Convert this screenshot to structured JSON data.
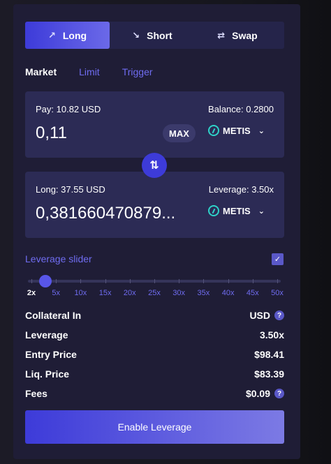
{
  "tabs": [
    {
      "label": "Long",
      "icon": "trend-up-icon",
      "glyph": "↗"
    },
    {
      "label": "Short",
      "icon": "trend-down-icon",
      "glyph": "↘"
    },
    {
      "label": "Swap",
      "icon": "swap-arrows-icon",
      "glyph": "⇄"
    }
  ],
  "order_types": [
    "Market",
    "Limit",
    "Trigger"
  ],
  "pay_box": {
    "pay_label": "Pay: 10.82 USD",
    "balance_label": "Balance: 0.2800",
    "amount": "0,11",
    "max_label": "MAX",
    "token": "METIS"
  },
  "long_box": {
    "long_label": "Long: 37.55 USD",
    "leverage_label": "Leverage: 3.50x",
    "amount": "0,381660470879...",
    "token": "METIS"
  },
  "leverage": {
    "label": "Leverage slider",
    "enabled": true,
    "marks": [
      "2x",
      "5x",
      "10x",
      "15x",
      "20x",
      "25x",
      "30x",
      "35x",
      "40x",
      "45x",
      "50x"
    ],
    "selected_fraction": 0.02
  },
  "info": [
    {
      "key": "Collateral In",
      "value": "USD",
      "help": true
    },
    {
      "key": "Leverage",
      "value": "3.50x",
      "help": false
    },
    {
      "key": "Entry Price",
      "value": "$98.41",
      "help": false
    },
    {
      "key": "Liq. Price",
      "value": "$83.39",
      "help": false
    },
    {
      "key": "Fees",
      "value": "$0.09",
      "help": true
    }
  ],
  "action": {
    "label": "Enable Leverage"
  },
  "colors": {
    "accent": "#3d3bd9",
    "panel": "#1f1d36",
    "box": "#2c2b55",
    "link": "#6f6cf0",
    "metis": "#2ed2c8"
  }
}
